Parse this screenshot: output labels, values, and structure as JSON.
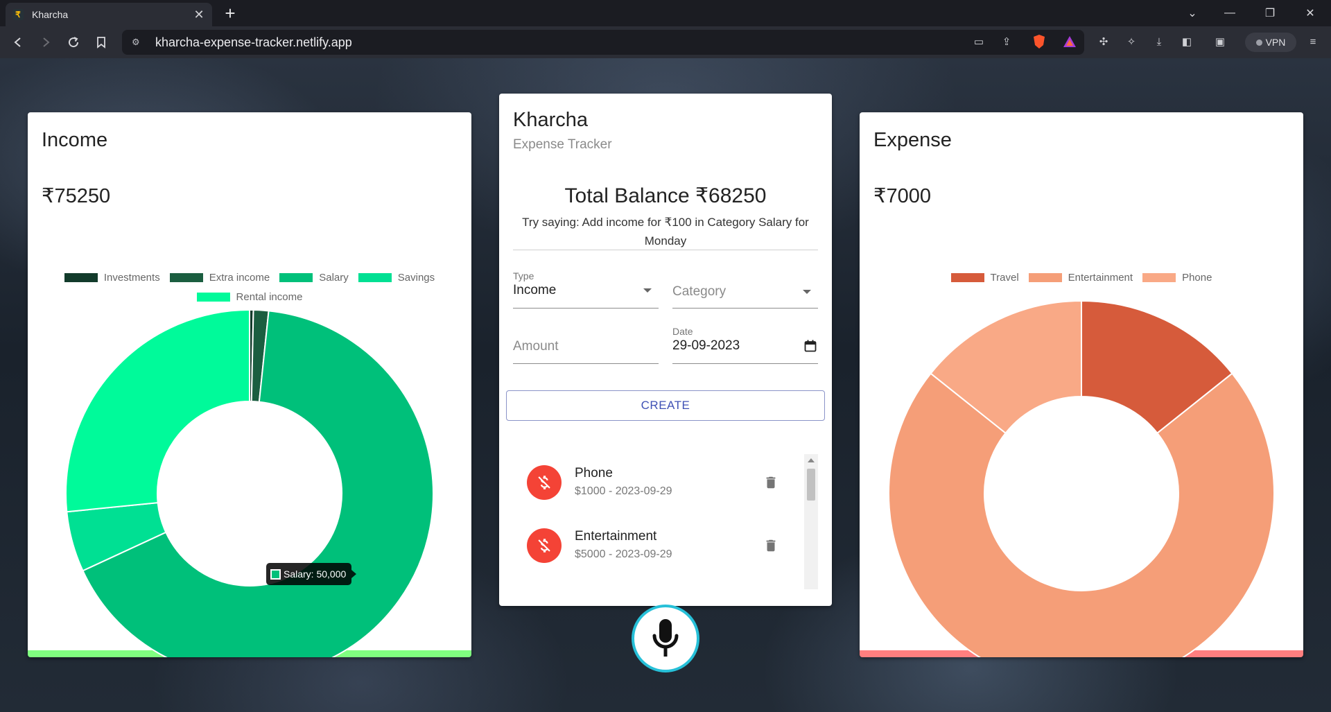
{
  "browser": {
    "tab_title": "Kharcha",
    "tab_close": "✕",
    "new_tab": "+",
    "url": "kharcha-expense-tracker.netlify.app",
    "vpn_label": "VPN"
  },
  "income": {
    "title": "Income",
    "total": "₹75250",
    "tooltip": "Salary: 50,000",
    "accent_color": "#80ff80"
  },
  "expense": {
    "title": "Expense",
    "total": "₹7000",
    "accent_color": "#ff7f7f"
  },
  "app": {
    "title": "Kharcha",
    "subtitle": "Expense Tracker",
    "balance": "Total Balance ₹68250",
    "hint": "Try saying: Add income for ₹100 in Category Salary for Monday",
    "form": {
      "type_label": "Type",
      "type_value": "Income",
      "category_placeholder": "Category",
      "amount_placeholder": "Amount",
      "date_label": "Date",
      "date_value": "29-09-2023",
      "create_label": "CREATE"
    },
    "transactions": [
      {
        "name": "Phone",
        "detail": "$1000 - 2023-09-29"
      },
      {
        "name": "Entertainment",
        "detail": "$5000 - 2023-09-29"
      }
    ]
  },
  "chart_data": [
    {
      "type": "pie",
      "title": "",
      "categories": [
        "Investments",
        "Extra income",
        "Salary",
        "Savings",
        "Rental income"
      ],
      "values": [
        250,
        1000,
        50000,
        4000,
        20000
      ],
      "colors": [
        "#123b2b",
        "#1b5e40",
        "#00c07a",
        "#00e093",
        "#00fa9a"
      ],
      "legend_position": "top"
    },
    {
      "type": "pie",
      "title": "",
      "categories": [
        "Travel",
        "Entertainment",
        "Phone"
      ],
      "values": [
        1000,
        5000,
        1000
      ],
      "colors": [
        "#d65b3b",
        "#f59e78",
        "#f9a986"
      ],
      "legend_position": "top"
    }
  ]
}
